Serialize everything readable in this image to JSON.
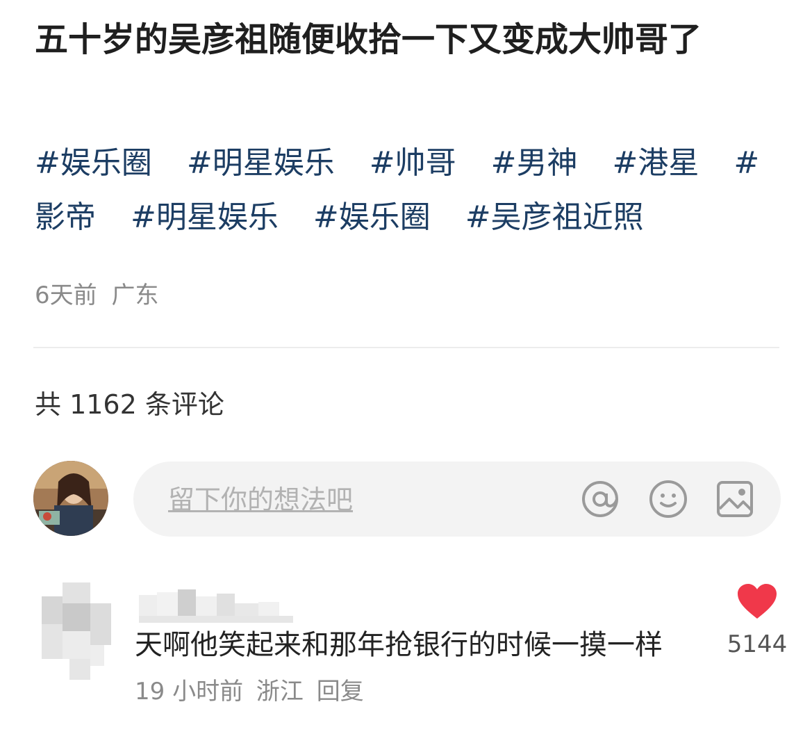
{
  "post": {
    "title": "五十岁的吴彦祖随便收拾一下又变成大帅哥了",
    "tags": [
      "#娱乐圈",
      "#明星娱乐",
      "#帅哥",
      "#男神",
      "#港星",
      "#影帝",
      "#明星娱乐",
      "#娱乐圈",
      "#吴彦祖近照"
    ],
    "time": "6天前",
    "location": "广东"
  },
  "comments_section": {
    "count_label": "共 1162 条评论",
    "input_placeholder": "留下你的想法吧",
    "icons": [
      "at-icon",
      "emoji-icon",
      "image-icon"
    ]
  },
  "comments": [
    {
      "text": "天啊他笑起来和那年抢银行的时候一摸一样",
      "time": "19 小时前",
      "location": "浙江",
      "reply_label": "回复",
      "likes": "5144",
      "like_color": "#f0384a"
    }
  ]
}
